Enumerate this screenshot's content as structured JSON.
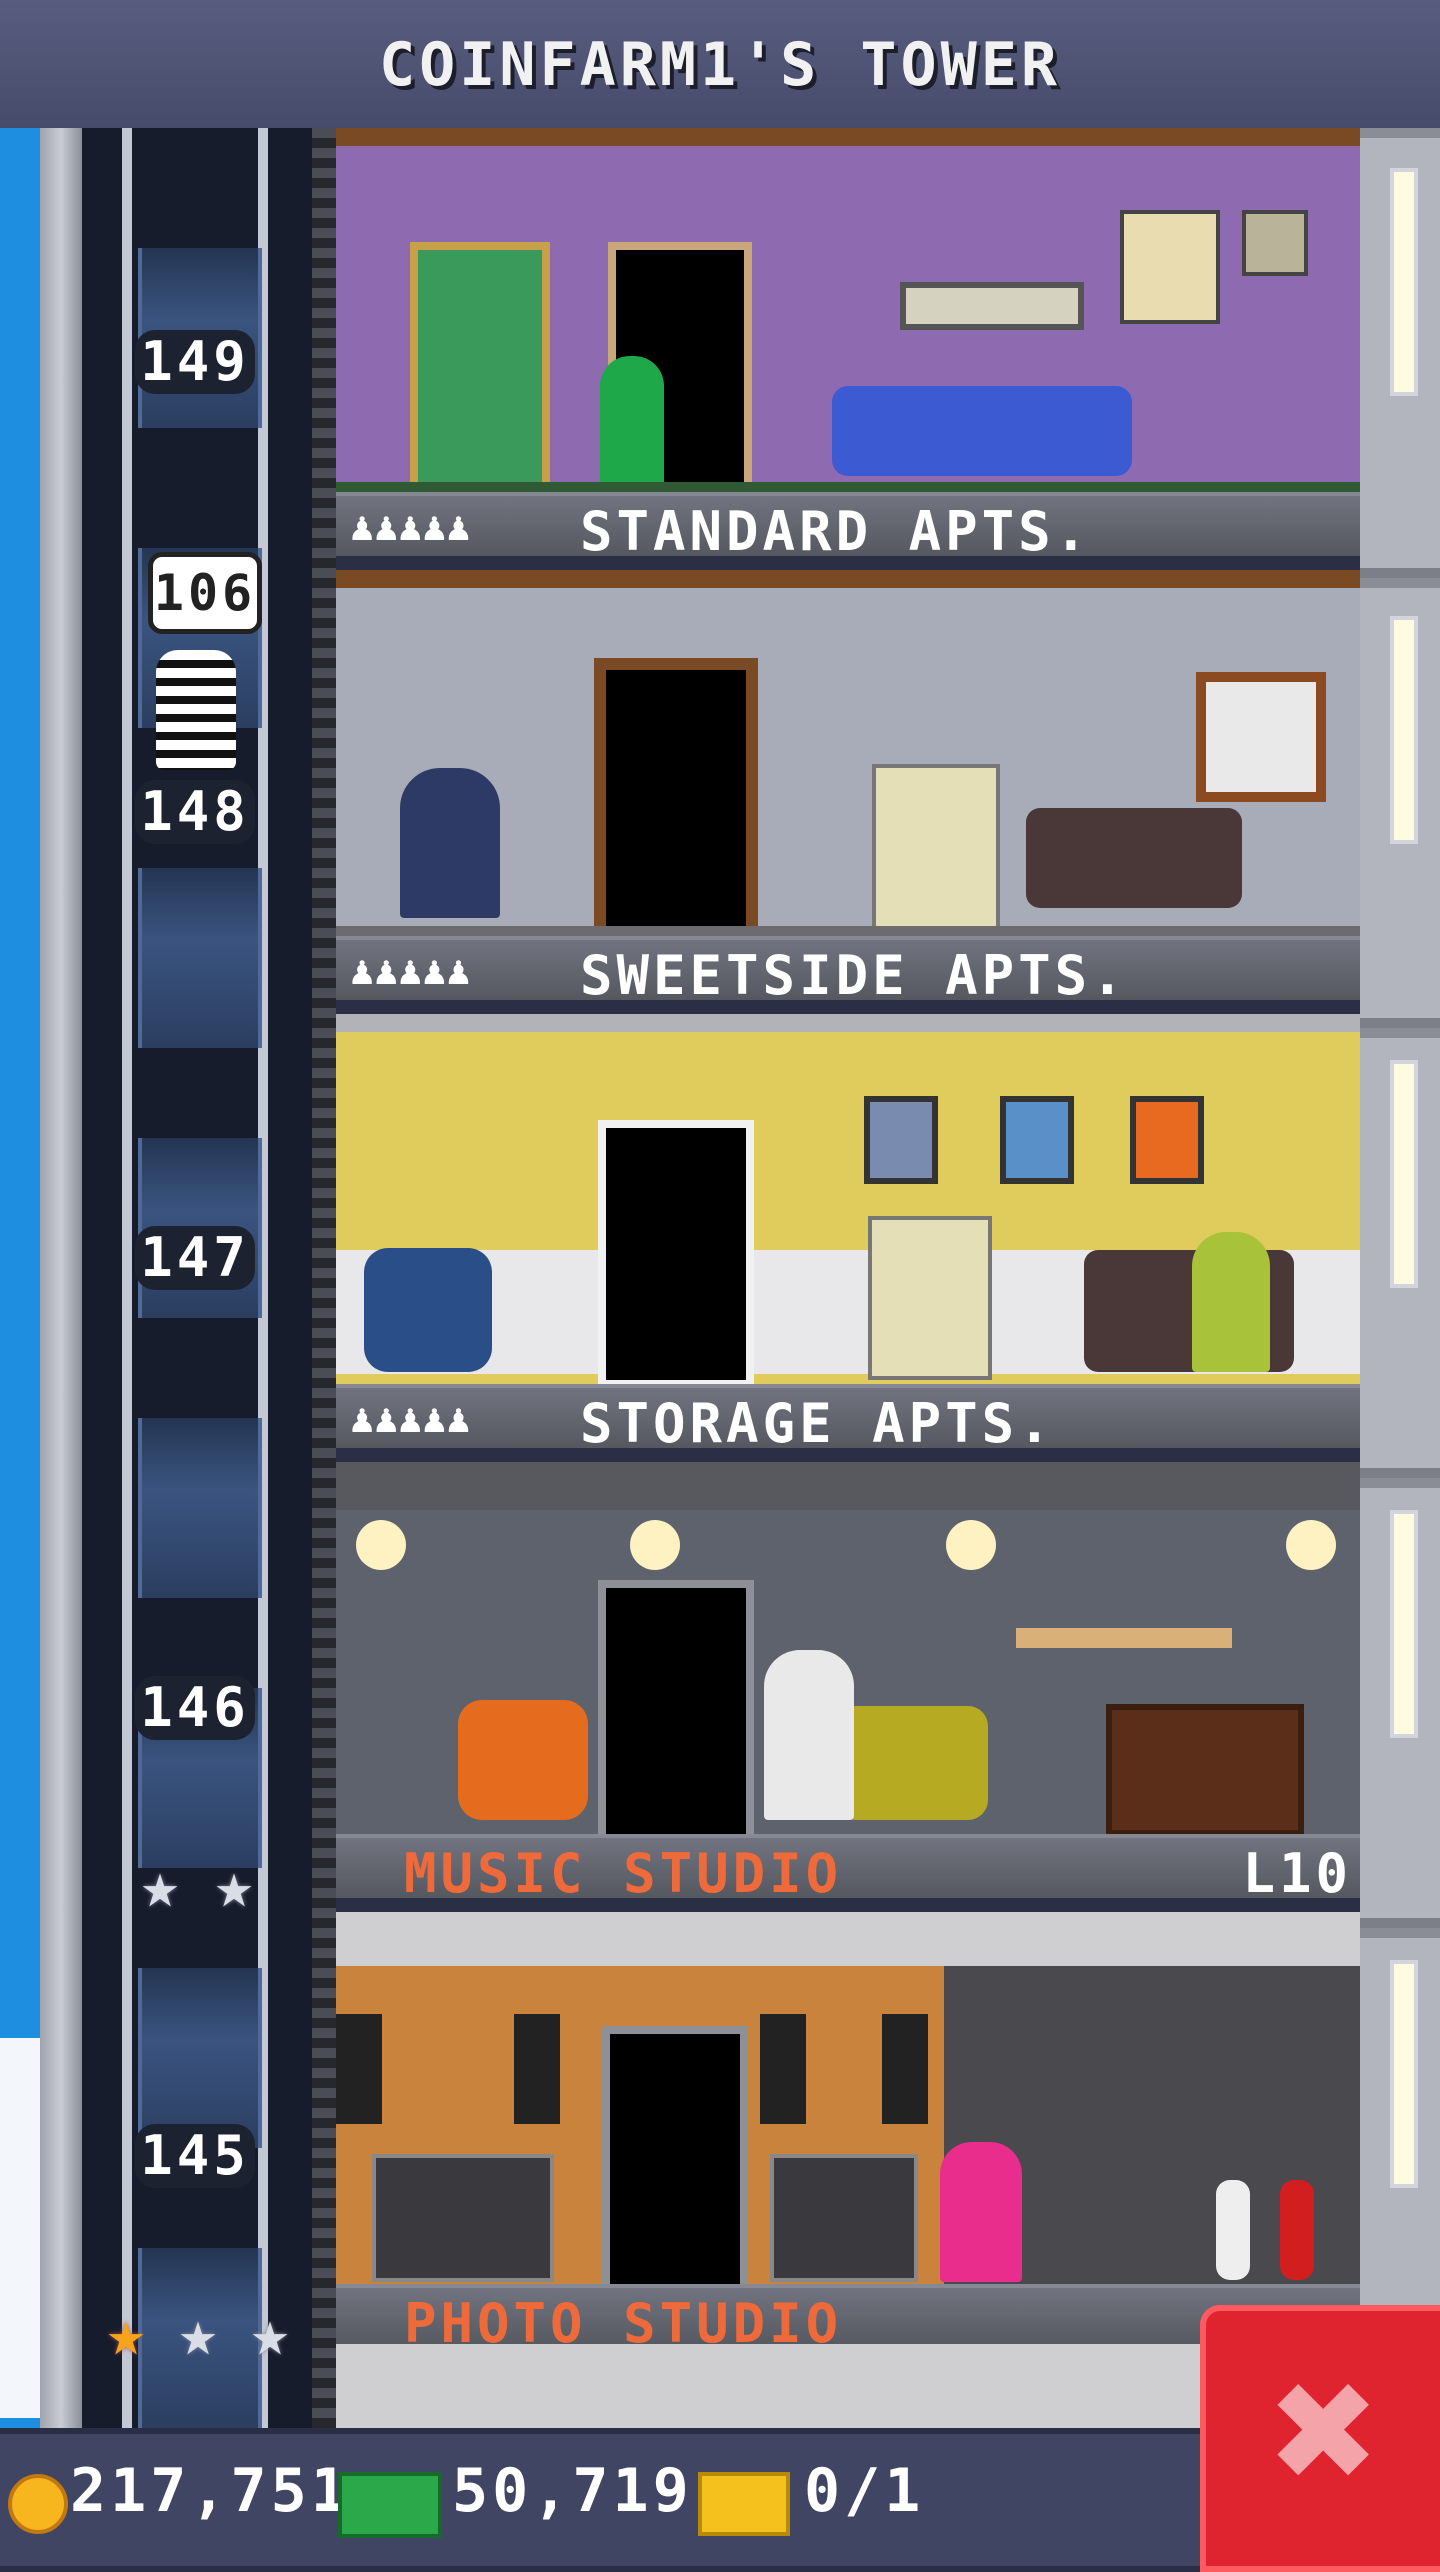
{
  "title": "COINFARM1'S TOWER",
  "floors": [
    {
      "number": "149",
      "name": "STANDARD APTS.",
      "residents_icon": "♟♟♟♟♟",
      "wall": "#8e6bb0"
    },
    {
      "number": "148",
      "name": "SWEETSIDE APTS.",
      "residents_icon": "♟♟♟♟♟",
      "wall": "#a7acb8"
    },
    {
      "number": "147",
      "name": "STORAGE APTS.",
      "residents_icon": "♟♟♟♟♟",
      "wall": "#e0cc5c"
    },
    {
      "number": "146",
      "name": "MUSIC STUDIO",
      "level": "L10",
      "wall": "#5d626c",
      "stars": 2
    },
    {
      "number": "145",
      "name": "PHOTO STUDIO",
      "wall": "#c9833c",
      "stars": 3,
      "gold_stars": 1
    }
  ],
  "elevator": {
    "bubble": "106"
  },
  "resources": {
    "coins": "217,751",
    "bux_cash": "50,719",
    "golden_tickets": "0/1"
  },
  "icons": {
    "coin": "coin-icon",
    "cash": "cash-icon",
    "ticket": "golden-ticket-icon",
    "close": "close-icon",
    "star": "star-icon"
  }
}
